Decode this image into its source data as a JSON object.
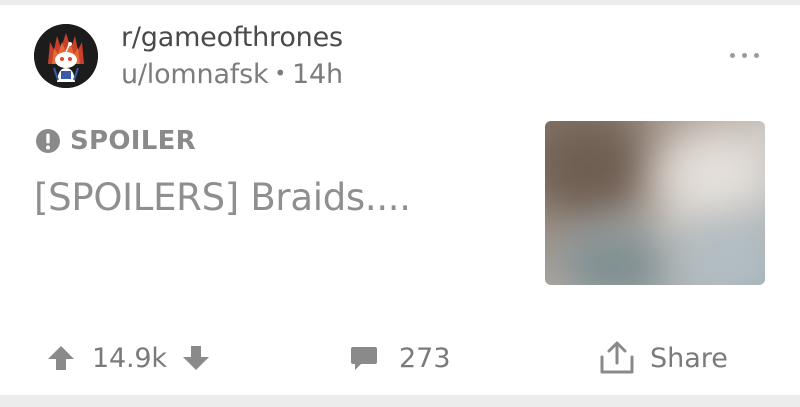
{
  "post": {
    "subreddit": "r/gameofthrones",
    "author": "u/lomnafsk",
    "separator": "•",
    "age": "14h",
    "flair": "SPOILER",
    "title": "[SPOILERS] Braids....",
    "thumbnail_state": "blurred-spoiler"
  },
  "actions": {
    "score": "14.9k",
    "comments": "273",
    "share_label": "Share"
  },
  "icons": {
    "more": "more-options-icon",
    "spoiler": "exclamation-circle-icon",
    "upvote": "upvote-arrow-icon",
    "downvote": "downvote-arrow-icon",
    "comment": "comment-bubble-icon",
    "share": "share-icon"
  },
  "colors": {
    "background": "#ececec",
    "card": "#ffffff",
    "primary_text": "#4a4a4a",
    "muted_text": "#7c7c7c",
    "title_spoiler": "#8f8f8f",
    "icon": "#8a8a8a"
  }
}
